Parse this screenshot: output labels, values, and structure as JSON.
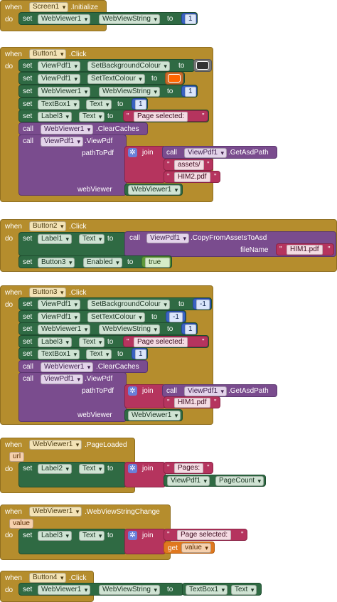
{
  "kw": {
    "when": "when",
    "do": "do",
    "set": "set",
    "to": "to",
    "call": "call",
    "join": "join",
    "get": "get"
  },
  "colors": {
    "swatch_dark": "#333333",
    "swatch_orange": "#ff6600"
  },
  "b1": {
    "component": "Screen1",
    "event": ".Initialize",
    "s1": {
      "comp": "WebViewer1",
      "prop": "WebViewString",
      "value": "1"
    }
  },
  "b2": {
    "component": "Button1",
    "event": ".Click",
    "s1": {
      "comp": "ViewPdf1",
      "prop": "SetBackgroundColour"
    },
    "s2": {
      "comp": "ViewPdf1",
      "prop": "SetTextColour"
    },
    "s3": {
      "comp": "WebViewer1",
      "prop": "WebViewString",
      "value": "1"
    },
    "s4": {
      "comp": "TextBox1",
      "prop": "Text",
      "value": "1"
    },
    "s5": {
      "comp": "Label3",
      "prop": "Text",
      "value": "Page selected:"
    },
    "c1": {
      "comp": "WebViewer1",
      "method": ".ClearCaches"
    },
    "c2": {
      "comp": "ViewPdf1",
      "method": ".ViewPdf",
      "arg1": "pathToPdf",
      "arg2": "webViewer",
      "inner_comp": "ViewPdf1",
      "inner_method": ".GetAsdPath",
      "str1": "assets/",
      "str2": "HIM2.pdf",
      "wv": "WebViewer1"
    }
  },
  "b3": {
    "component": "Button2",
    "event": ".Click",
    "s1": {
      "comp": "Label1",
      "prop": "Text",
      "call_comp": "ViewPdf1",
      "call_method": ".CopyFromAssetsToAsd",
      "arg": "fileName",
      "argval": "HIM1.pdf"
    },
    "s2": {
      "comp": "Button3",
      "prop": "Enabled",
      "value": "true"
    }
  },
  "b4": {
    "component": "Button3",
    "event": ".Click",
    "s1": {
      "comp": "ViewPdf1",
      "prop": "SetBackgroundColour",
      "value": "-1"
    },
    "s2": {
      "comp": "ViewPdf1",
      "prop": "SetTextColour",
      "value": "-1"
    },
    "s3": {
      "comp": "WebViewer1",
      "prop": "WebViewString",
      "value": "1"
    },
    "s4": {
      "comp": "Label3",
      "prop": "Text",
      "value": "Page selected:"
    },
    "s5": {
      "comp": "TextBox1",
      "prop": "Text",
      "value": "1"
    },
    "c1": {
      "comp": "WebViewer1",
      "method": ".ClearCaches"
    },
    "c2": {
      "comp": "ViewPdf1",
      "method": ".ViewPdf",
      "arg1": "pathToPdf",
      "arg2": "webViewer",
      "inner_comp": "ViewPdf1",
      "inner_method": ".GetAsdPath",
      "str1": "HIM1.pdf",
      "wv": "WebViewer1"
    }
  },
  "b5": {
    "component": "WebViewer1",
    "event": ".PageLoaded",
    "param": "url",
    "s1": {
      "comp": "Label2",
      "prop": "Text",
      "str": "Pages:",
      "comp2": "ViewPdf1",
      "prop2": "PageCount"
    }
  },
  "b6": {
    "component": "WebViewer1",
    "event": ".WebViewStringChange",
    "param": "value",
    "s1": {
      "comp": "Label3",
      "prop": "Text",
      "str": "Page selected:",
      "getvar": "value"
    }
  },
  "b7": {
    "component": "Button4",
    "event": ".Click",
    "s1": {
      "comp": "WebViewer1",
      "prop": "WebViewString",
      "comp2": "TextBox1",
      "prop2": "Text"
    }
  }
}
